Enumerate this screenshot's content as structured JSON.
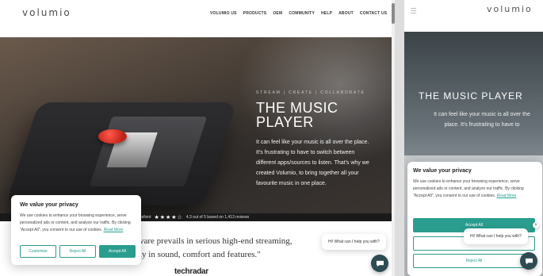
{
  "desktop": {
    "logo": "volumio",
    "nav": {
      "items": [
        {
          "label": "VOLUMIO US"
        },
        {
          "label": "PRODUCTS"
        },
        {
          "label": "OEM"
        },
        {
          "label": "COMMUNITY"
        },
        {
          "label": "HELP"
        },
        {
          "label": "ABOUT"
        },
        {
          "label": "CONTACT US"
        }
      ],
      "language": "EN"
    },
    "hero": {
      "tagline": "STREAM | CREATE | COLLABORATE",
      "title_line1": "THE MUSIC",
      "title_line2": "PLAYER",
      "body": "It can feel like your music is all over the place. It's frustrating to have to switch between different apps/sources to listen. That's why we created Volumio, to bring together all your favourite music in one place."
    },
    "rating": {
      "label": "cellent",
      "stars": "★★★★☆",
      "text": "4.3 out of 5 based on 1,413 reviews"
    },
    "quote": {
      "line1": "vare prevails in serious high-end streaming,",
      "line2": "ly in sound, comfort and features.\""
    },
    "source_logo": "techradar",
    "chat": {
      "greeting": "Hi! What can I help you with?"
    },
    "cookie": {
      "title": "We value your privacy",
      "body": "We use cookies to enhance your browsing experience, serve personalized ads or content, and analyze our traffic. By clicking \"Accept All\", you consent to our use of cookies.",
      "read_more": "Read More",
      "customize": "Customize",
      "reject": "Reject All",
      "accept": "Accept All"
    }
  },
  "mobile": {
    "logo": "volumio",
    "hero": {
      "title": "THE MUSIC PLAYER",
      "body": "It can feel like your music is all over the place. It's frustrating to have to"
    },
    "cookie": {
      "title": "We value your privacy",
      "body": "We use cookies to enhance your browsing experience, serve personalized ads or content, and analyze our traffic. By clicking \"Accept All\", you consent to our use of cookies.",
      "read_more": "Read More",
      "accept": "Accept All",
      "reject": "Reject All"
    },
    "chat": {
      "greeting": "Hi! What can I help you with?",
      "close": "×"
    }
  },
  "colors": {
    "accent": "#2a9d8f",
    "chat_button": "#2e4a52",
    "knob": "#d8281c"
  },
  "icons": [
    "flag-uk-icon",
    "chat-icon",
    "hamburger-icon",
    "star-icon",
    "close-icon"
  ]
}
